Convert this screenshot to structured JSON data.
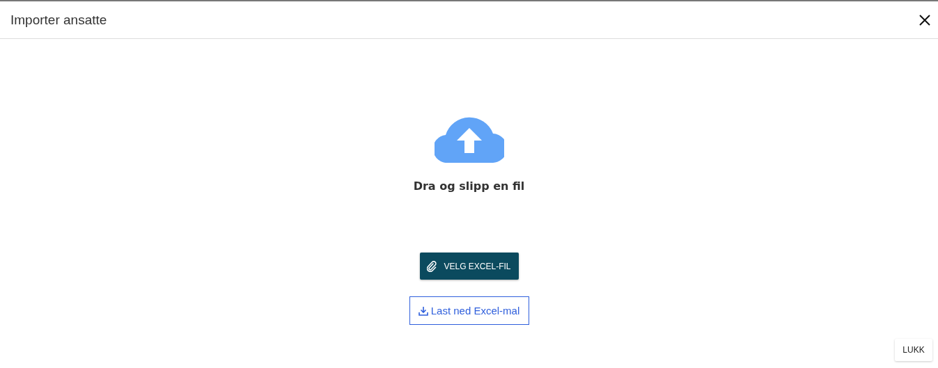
{
  "dialog": {
    "title": "Importer ansatte"
  },
  "dropzone": {
    "text": "Dra og slipp en fil"
  },
  "choose_button": {
    "label": "VELG EXCEL-FIL"
  },
  "download_link": {
    "label": "Last ned Excel-mal"
  },
  "footer": {
    "close_button": "LUKK"
  }
}
